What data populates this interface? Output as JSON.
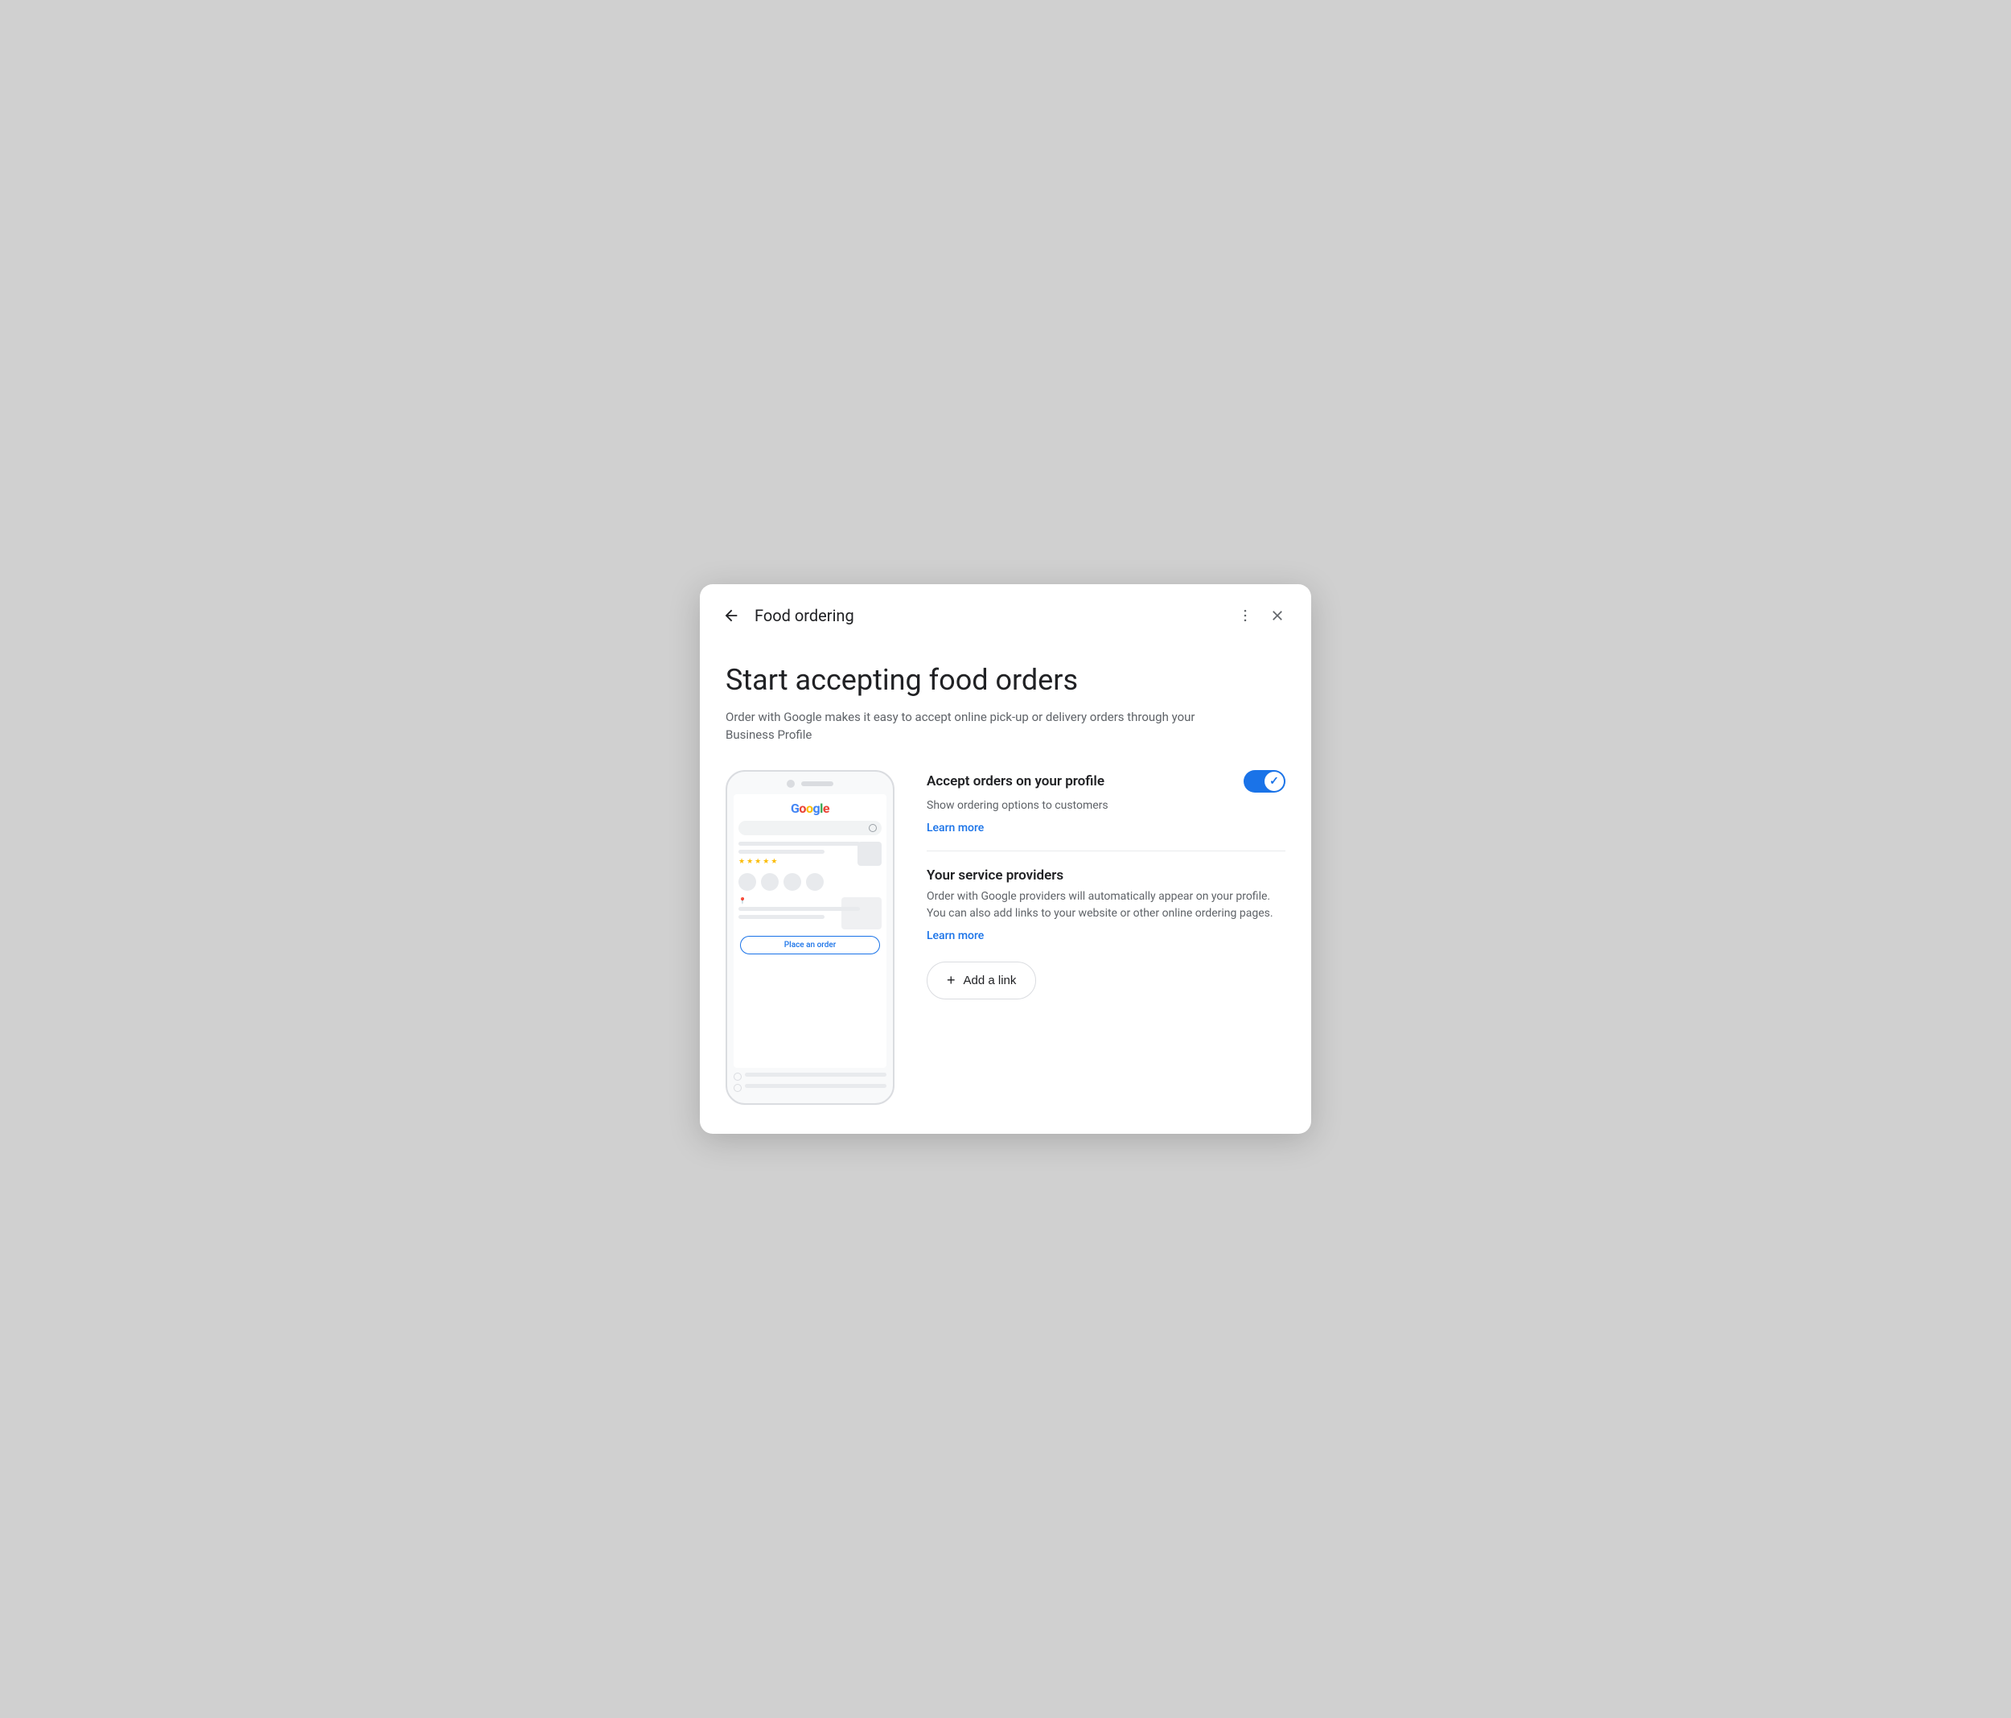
{
  "header": {
    "title": "Food ordering",
    "back_label": "Back",
    "more_label": "More options",
    "close_label": "Close"
  },
  "page": {
    "title": "Start accepting food orders",
    "subtitle": "Order with Google makes it easy to accept online pick-up or delivery orders through your Business Profile"
  },
  "phone_mockup": {
    "place_order_button": "Place an order"
  },
  "features": {
    "accept_orders": {
      "title": "Accept orders on your profile",
      "description": "Show ordering options to customers",
      "learn_more": "Learn more",
      "toggle_enabled": true
    },
    "service_providers": {
      "title": "Your service providers",
      "description": "Order with Google providers will automatically appear on your profile. You can also add links to your website or other online ordering pages.",
      "learn_more": "Learn more"
    }
  },
  "add_link_button": {
    "label": "Add a link",
    "plus_symbol": "+"
  }
}
